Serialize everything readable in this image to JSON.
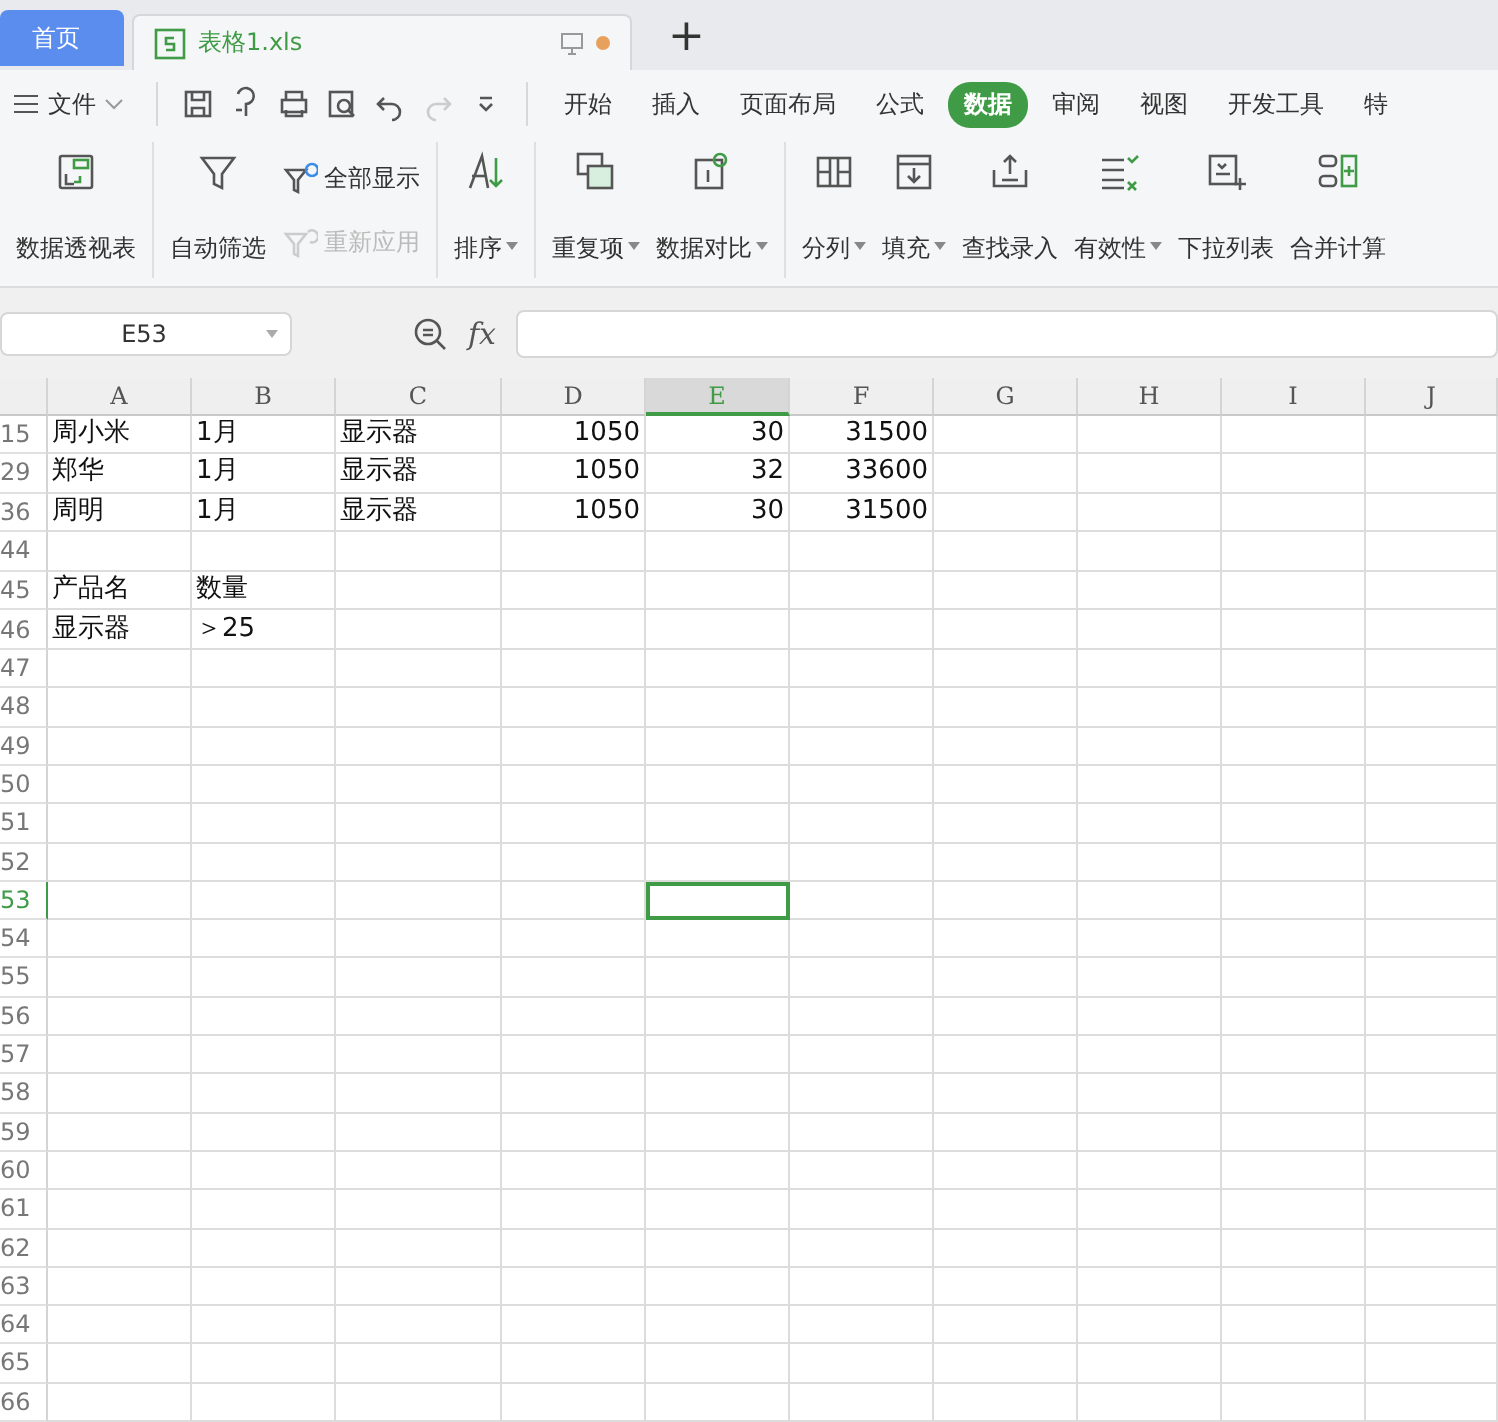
{
  "doc_tabs": [
    {
      "label": "首页",
      "kind": "home",
      "selected": false
    },
    {
      "label": "表格1.xls",
      "kind": "file",
      "selected": true,
      "unsaved": true
    }
  ],
  "new_tab": "+",
  "menu": {
    "file": "文件",
    "tabs": [
      {
        "label": "开始",
        "selected": false
      },
      {
        "label": "插入",
        "selected": false
      },
      {
        "label": "页面布局",
        "selected": false
      },
      {
        "label": "公式",
        "selected": false
      },
      {
        "label": "数据",
        "selected": true
      },
      {
        "label": "审阅",
        "selected": false
      },
      {
        "label": "视图",
        "selected": false
      },
      {
        "label": "开发工具",
        "selected": false
      },
      {
        "label": "特",
        "selected": false
      }
    ]
  },
  "ribbon": [
    {
      "items": [
        {
          "kind": "large",
          "label": "数据透视表",
          "dropdown": false
        }
      ]
    },
    {
      "items": [
        {
          "kind": "large",
          "label": "自动筛选",
          "dropdown": false
        },
        {
          "kind": "stack",
          "entries": [
            {
              "label": "全部显示",
              "disabled": false
            },
            {
              "label": "重新应用",
              "disabled": true
            }
          ]
        }
      ]
    },
    {
      "items": [
        {
          "kind": "large",
          "label": "排序",
          "dropdown": true
        }
      ]
    },
    {
      "items": [
        {
          "kind": "large",
          "label": "重复项",
          "dropdown": true
        },
        {
          "kind": "large",
          "label": "数据对比",
          "dropdown": true
        }
      ]
    },
    {
      "items": [
        {
          "kind": "large",
          "label": "分列",
          "dropdown": true
        },
        {
          "kind": "large",
          "label": "填充",
          "dropdown": true
        },
        {
          "kind": "large",
          "label": "查找录入",
          "dropdown": false
        },
        {
          "kind": "large",
          "label": "有效性",
          "dropdown": true
        },
        {
          "kind": "large",
          "label": "下拉列表",
          "dropdown": false
        },
        {
          "kind": "large",
          "label": "合并计算",
          "dropdown": false
        }
      ]
    }
  ],
  "formula_bar": {
    "name_box": "E53",
    "fx": "fx"
  },
  "columns": [
    {
      "label": "A",
      "selected": false
    },
    {
      "label": "B",
      "selected": false
    },
    {
      "label": "C",
      "selected": false
    },
    {
      "label": "D",
      "selected": false
    },
    {
      "label": "E",
      "selected": true
    },
    {
      "label": "F",
      "selected": false
    },
    {
      "label": "G",
      "selected": false
    },
    {
      "label": "H",
      "selected": false
    },
    {
      "label": "I",
      "selected": false
    },
    {
      "label": "J",
      "selected": false
    }
  ],
  "rows": [
    {
      "number": "15",
      "selected": false,
      "cells": [
        "周小米",
        "1月",
        "显示器",
        "1050",
        "30",
        "31500"
      ]
    },
    {
      "number": "29",
      "selected": false,
      "cells": [
        "郑华",
        "1月",
        "显示器",
        "1050",
        "32",
        "33600"
      ]
    },
    {
      "number": "36",
      "selected": false,
      "cells": [
        "周明",
        "1月",
        "显示器",
        "1050",
        "30",
        "31500"
      ]
    },
    {
      "number": "44",
      "selected": false
    },
    {
      "number": "45",
      "selected": false,
      "cells": [
        "产品名",
        "数量"
      ]
    },
    {
      "number": "46",
      "selected": false,
      "cells": [
        "显示器",
        "＞25"
      ]
    },
    {
      "number": "47",
      "selected": false
    },
    {
      "number": "48",
      "selected": false
    },
    {
      "number": "49",
      "selected": false
    },
    {
      "number": "50",
      "selected": false
    },
    {
      "number": "51",
      "selected": false
    },
    {
      "number": "52",
      "selected": false
    },
    {
      "number": "53",
      "selected": true
    },
    {
      "number": "54",
      "selected": false
    },
    {
      "number": "55",
      "selected": false
    },
    {
      "number": "56",
      "selected": false
    },
    {
      "number": "57",
      "selected": false
    },
    {
      "number": "58",
      "selected": false
    },
    {
      "number": "59",
      "selected": false
    },
    {
      "number": "60",
      "selected": false
    },
    {
      "number": "61",
      "selected": false
    },
    {
      "number": "62",
      "selected": false
    },
    {
      "number": "63",
      "selected": false
    },
    {
      "number": "64",
      "selected": false
    },
    {
      "number": "65",
      "selected": false
    },
    {
      "number": "66",
      "selected": false
    }
  ]
}
